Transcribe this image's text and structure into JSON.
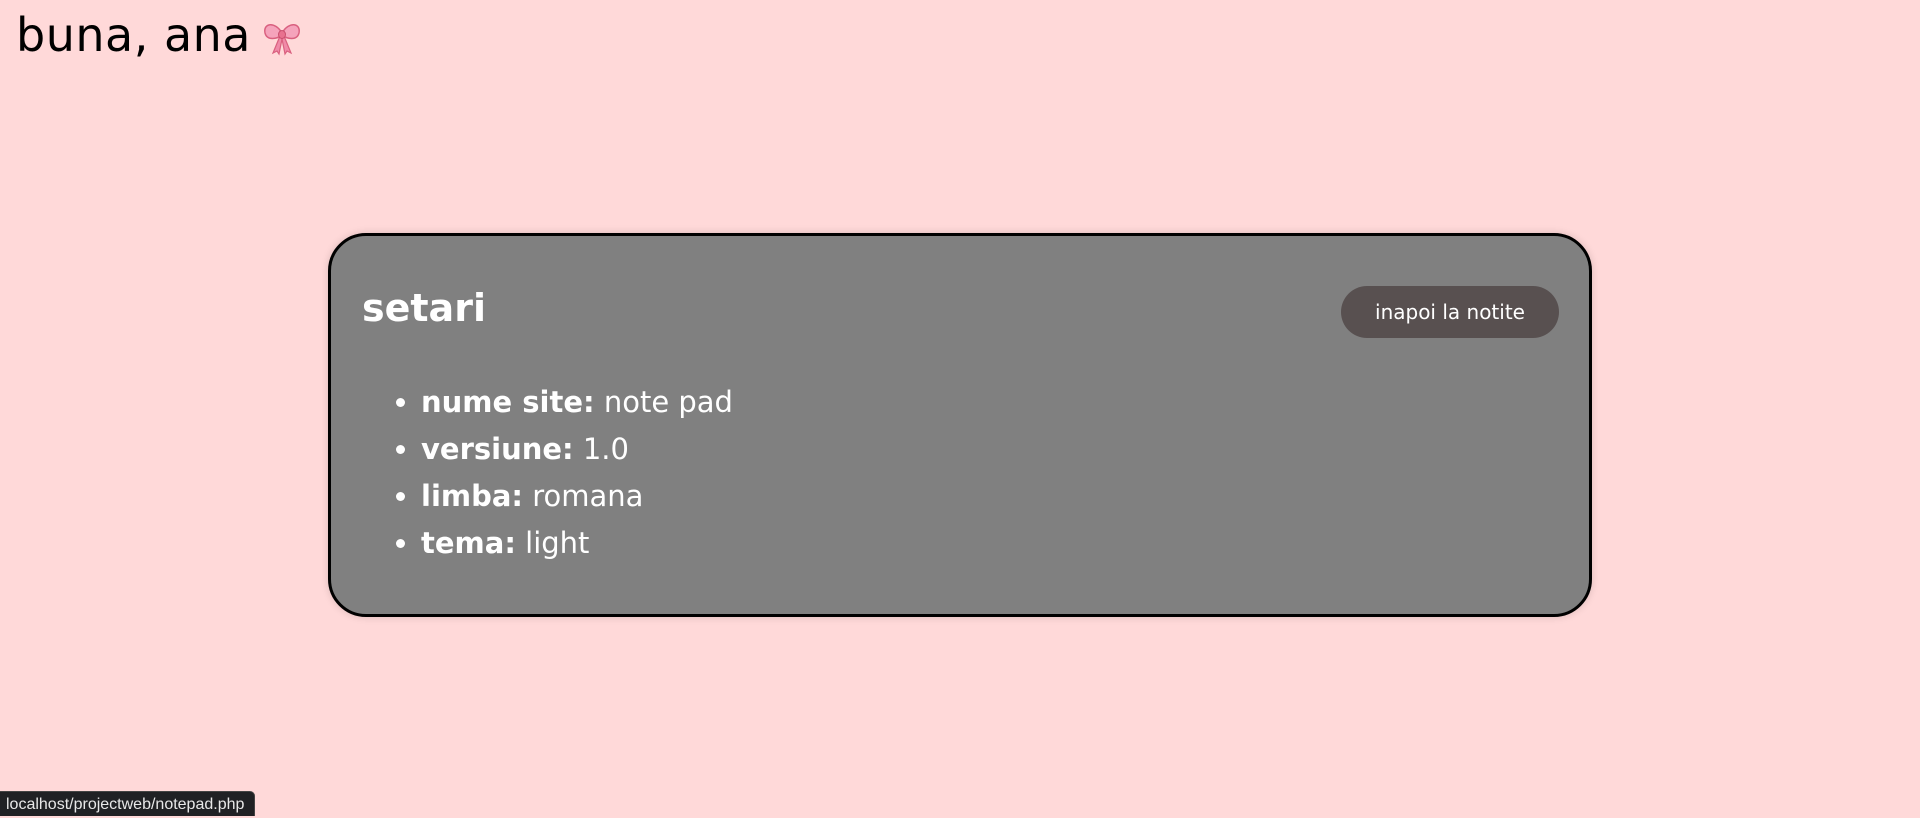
{
  "header": {
    "greeting": "buna, ana",
    "icon": "bow-icon"
  },
  "settings": {
    "title": "setari",
    "back_button_label": "inapoi la notite",
    "items": [
      {
        "label": "nume site:",
        "value": " note pad"
      },
      {
        "label": "versiune:",
        "value": " 1.0"
      },
      {
        "label": "limba:",
        "value": " romana"
      },
      {
        "label": "tema:",
        "value": " light"
      }
    ]
  },
  "status_bar": {
    "url": "localhost/projectweb/notepad.php"
  },
  "colors": {
    "background": "#ffd9d9",
    "card": "#808080",
    "button": "#585050",
    "bow": "#f08aa8"
  }
}
